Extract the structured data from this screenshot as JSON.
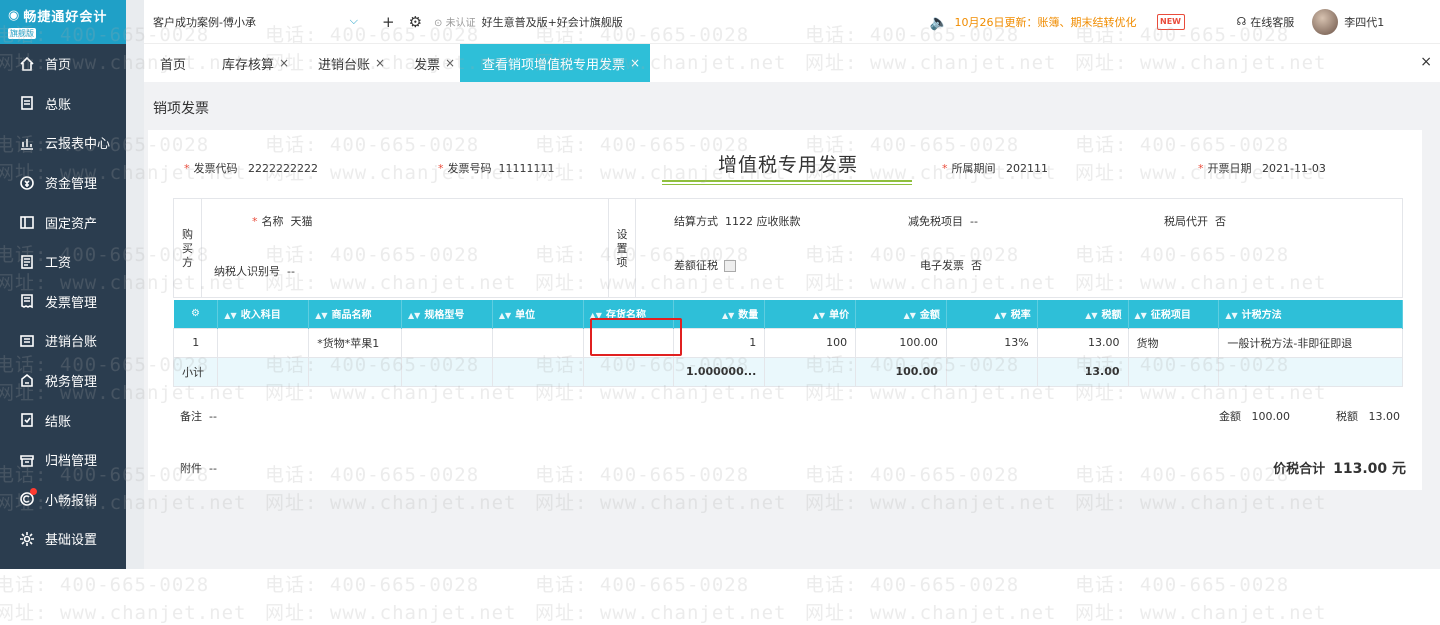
{
  "app": {
    "name": "畅捷通好会计",
    "badge": "旗舰版"
  },
  "sidebar": {
    "items": [
      {
        "label": "首页",
        "icon": "home-icon"
      },
      {
        "label": "总账",
        "icon": "ledger-icon"
      },
      {
        "label": "云报表中心",
        "icon": "chart-icon"
      },
      {
        "label": "资金管理",
        "icon": "money-icon"
      },
      {
        "label": "固定资产",
        "icon": "asset-icon"
      },
      {
        "label": "工资",
        "icon": "salary-icon"
      },
      {
        "label": "发票管理",
        "icon": "invoice-icon"
      },
      {
        "label": "进销台账",
        "icon": "book-icon"
      },
      {
        "label": "税务管理",
        "icon": "tax-icon"
      },
      {
        "label": "结账",
        "icon": "close-books-icon"
      },
      {
        "label": "归档管理",
        "icon": "archive-icon"
      },
      {
        "label": "小畅报销",
        "icon": "reimburse-icon"
      },
      {
        "label": "基础设置",
        "icon": "gear-icon"
      }
    ]
  },
  "topbar": {
    "account": "客户成功案例-傅小承",
    "cert": "未认证",
    "version": "好生意普及版+好会计旗舰版",
    "news": "10月26日更新：账簿、期末结转优化",
    "new_badge": "NEW",
    "service": "在线客服",
    "user": "李四代1"
  },
  "tabs": [
    {
      "label": "首页",
      "closable": false
    },
    {
      "label": "库存核算",
      "closable": true
    },
    {
      "label": "进销台账",
      "closable": true
    },
    {
      "label": "发票",
      "closable": true
    },
    {
      "label": "查看销项增值税专用发票",
      "closable": true
    }
  ],
  "close_glyph": "×",
  "page": {
    "title": "销项发票"
  },
  "invoice": {
    "title": "增值税专用发票",
    "code_label": "发票代码",
    "code": "2222222222",
    "number_label": "发票号码",
    "number": "11111111",
    "period_label": "所属期间",
    "period": "202111",
    "date_label": "开票日期",
    "date": "2021-11-03",
    "buyer_label": "购买方",
    "name_label": "名称",
    "name": "天猫",
    "taxid_label": "纳税人识别号",
    "taxid": "--",
    "settings_label": "设置项",
    "settle_label": "结算方式",
    "settle": "1122 应收账款",
    "exempt_label": "减免税项目",
    "exempt": "--",
    "agent_label": "税局代开",
    "agent": "否",
    "diff_label": "差额征税",
    "einv_label": "电子发票",
    "einv": "否",
    "remark_label": "备注",
    "remark": "--",
    "attach_label": "附件",
    "attach": "--",
    "amount_label": "金额",
    "amount": "100.00",
    "tax_label": "税额",
    "tax": "13.00",
    "total_label": "价税合计",
    "total": "113.00 元"
  },
  "grid": {
    "headers": [
      "收入科目",
      "商品名称",
      "规格型号",
      "单位",
      "存货名称",
      "数量",
      "单价",
      "金额",
      "税率",
      "税额",
      "征税项目",
      "计税方法"
    ],
    "rows": [
      [
        "1",
        "",
        "*货物*苹果1",
        "",
        "",
        "",
        "1",
        "100",
        "100.00",
        "13%",
        "13.00",
        "货物",
        "一般计税方法-非即征即退"
      ]
    ],
    "subtotal": {
      "label": "小计",
      "qty": "1.000000...",
      "amount": "100.00",
      "tax": "13.00"
    }
  },
  "watermark": {
    "phone": "电话: 400-665-0028",
    "site": "网址: www.chanjet.net"
  },
  "colors": {
    "sidebar": "#2b3d4f",
    "accent": "#2ebfd8",
    "highlight": "#e02020"
  }
}
